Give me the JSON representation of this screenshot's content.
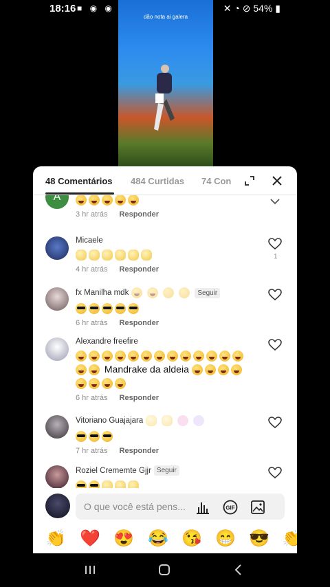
{
  "status": {
    "time": "18:16",
    "battery": "54%"
  },
  "video": {
    "caption": "dão nota ai galera"
  },
  "tabs": [
    {
      "label": "48 Comentários"
    },
    {
      "label": "484 Curtidas"
    },
    {
      "label": "74 Con"
    }
  ],
  "comments": [
    {
      "avatar_initial": "A",
      "time": "3 hr atrás",
      "reply": "Responder"
    },
    {
      "username": "Micaele",
      "time": "4 hr atrás",
      "reply": "Responder",
      "likes": "1"
    },
    {
      "username": "fx Manilha mdk",
      "follow": "Seguir",
      "time": "6 hr atrás",
      "reply": "Responder"
    },
    {
      "username": "Alexandre freefire",
      "text": "Mandrake da aldeia",
      "time": "6 hr atrás",
      "reply": "Responder"
    },
    {
      "username": "Vitoriano Guajajara",
      "time": "7 hr atrás",
      "reply": "Responder"
    },
    {
      "username": "Roziel Crememte Gjjr",
      "follow": "Seguir"
    }
  ],
  "composer": {
    "placeholder": "O que você está pens..."
  },
  "reactions": [
    "👏",
    "❤️",
    "😍",
    "😂",
    "😘",
    "😁",
    "😎",
    "👏"
  ],
  "colors": {
    "accent": "#222222",
    "heart_red": "#e0245e"
  }
}
